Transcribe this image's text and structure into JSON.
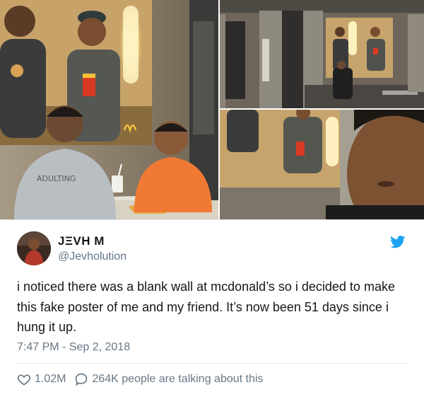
{
  "photos": {
    "main_alt_icons": [
      "photo-main"
    ],
    "shirt_print": "ADULTING"
  },
  "tweet": {
    "display_name": "JΞVH M",
    "handle": "@Jevholution",
    "text": "i noticed there was a blank wall at mcdonald’s so i decided to make this fake poster of me and my friend. It’s now been 51 days since i hung it up.",
    "timestamp": "7:47 PM - Sep 2, 2018",
    "likes": "1.02M",
    "replies_text": "264K people are talking about this"
  },
  "colors": {
    "twitter_blue": "#1da1f2",
    "secondary_text": "#657786",
    "primary_text": "#14171a"
  },
  "icons": {
    "brand": "twitter-bird-icon",
    "like": "heart-icon",
    "reply": "speech-bubble-icon"
  }
}
